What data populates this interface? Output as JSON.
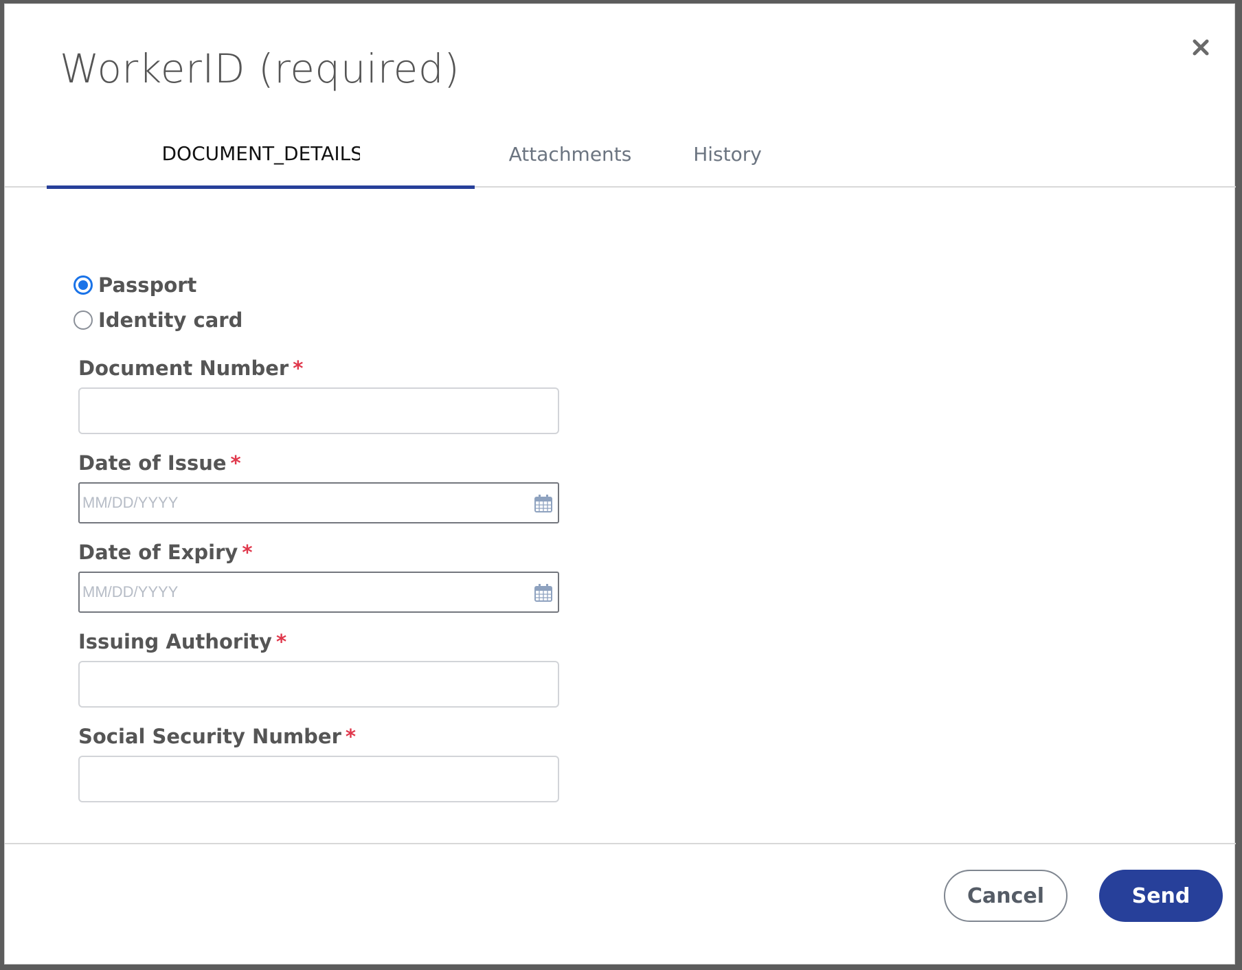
{
  "dialog": {
    "title": "WorkerID (required)",
    "close_label": "close"
  },
  "tabs": [
    {
      "label": "DOCUMENT_DETAILS:",
      "active": true
    },
    {
      "label": "Attachments",
      "active": false
    },
    {
      "label": "History",
      "active": false
    }
  ],
  "document_type": {
    "options": [
      {
        "label": "Passport",
        "checked": true
      },
      {
        "label": "Identity card",
        "checked": false
      }
    ]
  },
  "fields": {
    "document_number": {
      "label": "Document Number",
      "required_mark": "*",
      "value": ""
    },
    "date_of_issue": {
      "label": "Date of Issue",
      "required_mark": "*",
      "placeholder": "MM/DD/YYYY",
      "value": ""
    },
    "date_of_expiry": {
      "label": "Date of Expiry",
      "required_mark": "*",
      "placeholder": "MM/DD/YYYY",
      "value": ""
    },
    "issuing_authority": {
      "label": "Issuing Authority",
      "required_mark": "*",
      "value": ""
    },
    "social_security_number": {
      "label": "Social Security Number",
      "required_mark": "*",
      "value": ""
    }
  },
  "footer": {
    "cancel_label": "Cancel",
    "send_label": "Send"
  },
  "colors": {
    "accent": "#27409a",
    "radio_selected": "#1a73e8",
    "required": "#e0384c"
  }
}
